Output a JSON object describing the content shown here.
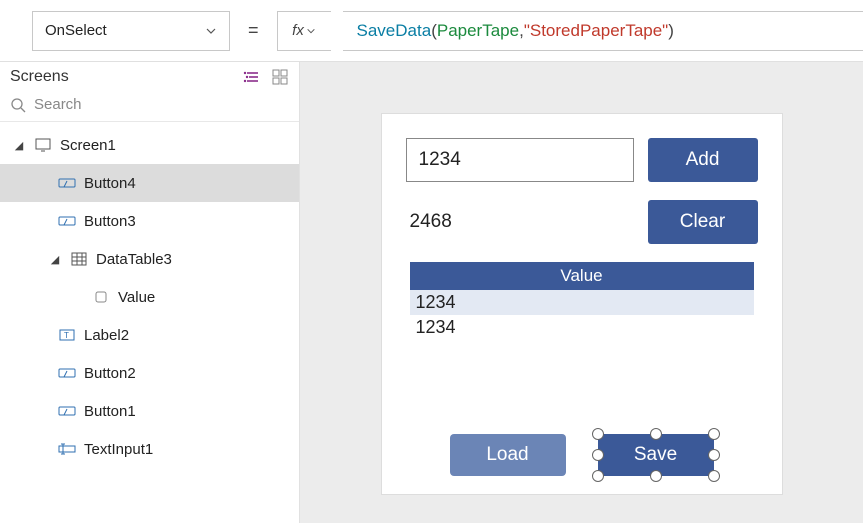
{
  "formula": {
    "property": "OnSelect",
    "func": "SaveData",
    "open": "( ",
    "ident": "PaperTape",
    "comma": ", ",
    "string": "\"StoredPaperTape\"",
    "close": " )"
  },
  "panel": {
    "title": "Screens",
    "search_placeholder": "Search"
  },
  "tree": {
    "screen1": "Screen1",
    "button4": "Button4",
    "button3": "Button3",
    "datatable3": "DataTable3",
    "value": "Value",
    "label2": "Label2",
    "button2": "Button2",
    "button1": "Button1",
    "textinput1": "TextInput1"
  },
  "app": {
    "input_value": "1234",
    "label_value": "2468",
    "add": "Add",
    "clear": "Clear",
    "table_header": "Value",
    "rows": [
      "1234",
      "1234"
    ],
    "load": "Load",
    "save": "Save"
  }
}
